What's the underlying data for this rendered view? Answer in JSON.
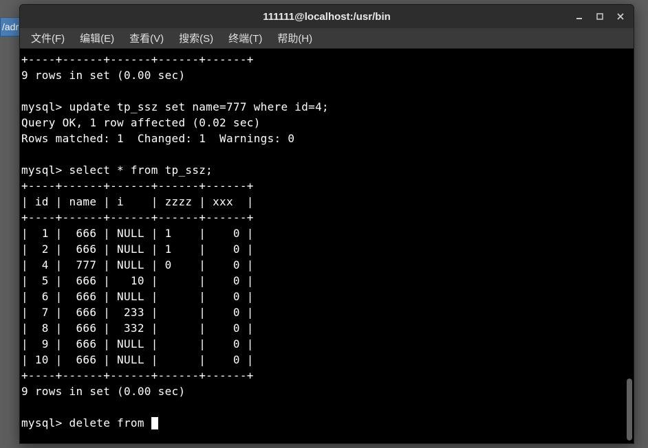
{
  "bg": {
    "text": "/adr"
  },
  "window": {
    "title": "111111@localhost:/usr/bin"
  },
  "menubar": {
    "items": [
      {
        "label": "文件(F)"
      },
      {
        "label": "编辑(E)"
      },
      {
        "label": "查看(V)"
      },
      {
        "label": "搜索(S)"
      },
      {
        "label": "终端(T)"
      },
      {
        "label": "帮助(H)"
      }
    ]
  },
  "terminal": {
    "lines": [
      "+----+------+------+------+------+",
      "9 rows in set (0.00 sec)",
      "",
      "mysql> update tp_ssz set name=777 where id=4;",
      "Query OK, 1 row affected (0.02 sec)",
      "Rows matched: 1  Changed: 1  Warnings: 0",
      "",
      "mysql> select * from tp_ssz;",
      "+----+------+------+------+------+",
      "| id | name | i    | zzzz | xxx  |",
      "+----+------+------+------+------+",
      "|  1 |  666 | NULL | 1    |    0 |",
      "|  2 |  666 | NULL | 1    |    0 |",
      "|  4 |  777 | NULL | 0    |    0 |",
      "|  5 |  666 |   10 |      |    0 |",
      "|  6 |  666 | NULL |      |    0 |",
      "|  7 |  666 |  233 |      |    0 |",
      "|  8 |  666 |  332 |      |    0 |",
      "|  9 |  666 | NULL |      |    0 |",
      "| 10 |  666 | NULL |      |    0 |",
      "+----+------+------+------+------+",
      "9 rows in set (0.00 sec)",
      ""
    ],
    "prompt_line": "mysql> delete from "
  }
}
